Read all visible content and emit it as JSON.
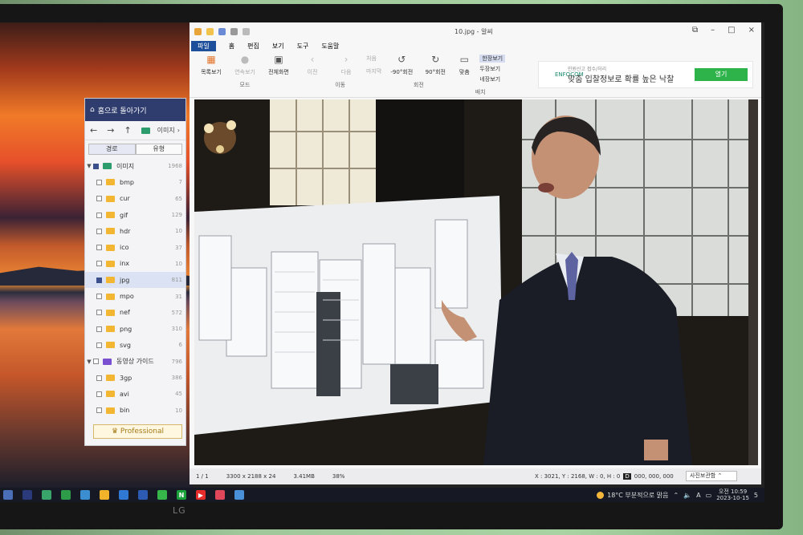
{
  "explorer": {
    "home_label": "홈으로 돌아가기",
    "crumb": "이미지",
    "tabs": [
      "경로",
      "유형"
    ],
    "tree": [
      {
        "label": "이미지",
        "count": "1968"
      },
      {
        "label": "bmp",
        "count": "7"
      },
      {
        "label": "cur",
        "count": "65"
      },
      {
        "label": "gif",
        "count": "129"
      },
      {
        "label": "hdr",
        "count": "10"
      },
      {
        "label": "ico",
        "count": "37"
      },
      {
        "label": "inx",
        "count": "10"
      },
      {
        "label": "jpg",
        "count": "811"
      },
      {
        "label": "mpo",
        "count": "31"
      },
      {
        "label": "nef",
        "count": "572"
      },
      {
        "label": "png",
        "count": "310"
      },
      {
        "label": "svg",
        "count": "6"
      },
      {
        "label": "동영상 가이드",
        "count": "796"
      },
      {
        "label": "3gp",
        "count": "386"
      },
      {
        "label": "avi",
        "count": "45"
      },
      {
        "label": "bin",
        "count": "10"
      }
    ],
    "pro_label": "Professional"
  },
  "viewer": {
    "title": "10.jpg - 알씨",
    "menu": [
      "파일",
      "홈",
      "편집",
      "보기",
      "도구",
      "도움말"
    ],
    "ribbon": {
      "group1": {
        "buttons": [
          "목록보기",
          "연속보기",
          "전체화면"
        ],
        "label": "모드"
      },
      "group2": {
        "buttons": [
          "이전",
          "다음",
          "처음",
          "마지막"
        ],
        "label": "이동"
      },
      "group3": {
        "buttons": [
          "-90°회전",
          "90°회전"
        ],
        "label": "회전"
      },
      "group4": {
        "buttons": [
          "맞춤",
          "한장보기",
          "두장보기",
          "네장보기"
        ],
        "label": "배치"
      }
    },
    "ad": {
      "logo": "ENFOCOM",
      "small": "민원신고 접수/처리",
      "text": "맞춤 입찰정보로 확률 높은 낙찰",
      "cta": "열기"
    },
    "status": {
      "page": "1 / 1",
      "dims": "3300 x 2188 x 24",
      "size": "3.41MB",
      "zoom": "38%",
      "coords": "X : 3021, Y : 2168, W : 0, H : 0",
      "chip": "D",
      "color": "000, 000, 000",
      "btn": "사진보관함"
    }
  },
  "taskbar": {
    "weather": "18°C 부분적으로 맑음",
    "tray_lang": "A",
    "time": "오전 10:59",
    "date": "2023-10-15",
    "badge": "5"
  },
  "monitor_brand": "LG"
}
